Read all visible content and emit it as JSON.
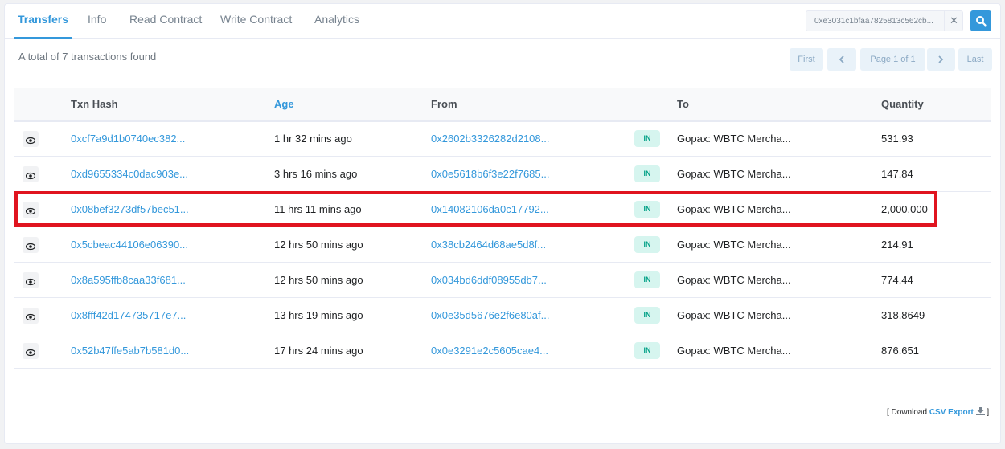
{
  "tabs": [
    "Transfers",
    "Info",
    "Read Contract",
    "Write Contract",
    "Analytics"
  ],
  "search": {
    "value": "0xe3031c1bfaa7825813c562cb..."
  },
  "summary": "A total of 7 transactions found",
  "pagination": {
    "first": "First",
    "page": "Page 1 of 1",
    "last": "Last"
  },
  "table": {
    "headers": [
      "",
      "Txn Hash",
      "Age",
      "From",
      "",
      "To",
      "Quantity"
    ],
    "rows": [
      {
        "hash": "0xcf7a9d1b0740ec382...",
        "age": "1 hr 32 mins ago",
        "from": "0x2602b3326282d2108...",
        "dir": "IN",
        "to": "Gopax: WBTC Mercha...",
        "qty": "531.93"
      },
      {
        "hash": "0xd9655334c0dac903e...",
        "age": "3 hrs 16 mins ago",
        "from": "0x0e5618b6f3e22f7685...",
        "dir": "IN",
        "to": "Gopax: WBTC Mercha...",
        "qty": "147.84"
      },
      {
        "hash": "0x08bef3273df57bec51...",
        "age": "11 hrs 11 mins ago",
        "from": "0x14082106da0c17792...",
        "dir": "IN",
        "to": "Gopax: WBTC Mercha...",
        "qty": "2,000,000"
      },
      {
        "hash": "0x5cbeac44106e06390...",
        "age": "12 hrs 50 mins ago",
        "from": "0x38cb2464d68ae5d8f...",
        "dir": "IN",
        "to": "Gopax: WBTC Mercha...",
        "qty": "214.91"
      },
      {
        "hash": "0x8a595ffb8caa33f681...",
        "age": "12 hrs 50 mins ago",
        "from": "0x034bd6ddf08955db7...",
        "dir": "IN",
        "to": "Gopax: WBTC Mercha...",
        "qty": "774.44"
      },
      {
        "hash": "0x8fff42d174735717e7...",
        "age": "13 hrs 19 mins ago",
        "from": "0x0e35d5676e2f6e80af...",
        "dir": "IN",
        "to": "Gopax: WBTC Mercha...",
        "qty": "318.8649"
      },
      {
        "hash": "0x52b47ffe5ab7b581d0...",
        "age": "17 hrs 24 mins ago",
        "from": "0x0e3291e2c5605cae4...",
        "dir": "IN",
        "to": "Gopax: WBTC Mercha...",
        "qty": "876.651"
      }
    ]
  },
  "download": {
    "prefix": "[ Download",
    "link": "CSV Export",
    "suffix": "]"
  },
  "colors": {
    "accent": "#3498db",
    "highlight": "#e0141f",
    "badge_bg": "#d6f5ef",
    "badge_text": "#00a186"
  },
  "icons": {
    "search": "search-icon",
    "clear": "close-icon",
    "view": "eye-icon",
    "download": "download-icon",
    "prev": "chevron-left-icon",
    "next": "chevron-right-icon"
  }
}
